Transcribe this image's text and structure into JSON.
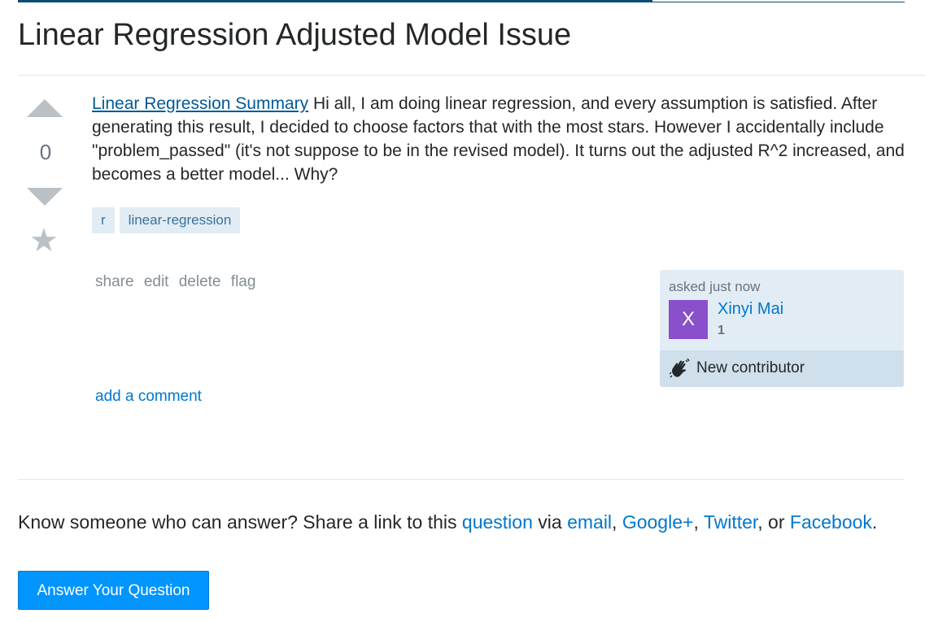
{
  "question": {
    "title": "Linear Regression Adjusted Model Issue",
    "vote_count": "0",
    "body_link": "Linear Regression Summary",
    "body_text": " Hi all, I am doing linear regression, and every assumption is satisfied. After generating this result, I decided to choose factors that with the most stars. However I accidentally include \"problem_passed\" (it's not suppose to be in the revised model). It turns out the adjusted R^2 increased, and becomes a better model... Why?",
    "tags": [
      "r",
      "linear-regression"
    ]
  },
  "post_menu": {
    "share": "share",
    "edit": "edit",
    "delete": "delete",
    "flag": "flag"
  },
  "owner": {
    "asked": "asked just now",
    "avatar_letter": "X",
    "name": "Xinyi Mai",
    "reputation": "1",
    "badge": "New contributor"
  },
  "add_comment": "add a comment",
  "share_prompt": {
    "prefix": "Know someone who can answer? Share a link to this ",
    "question_link": "question",
    "via": " via ",
    "email": "email",
    "sep1": ", ",
    "google": "Google+",
    "sep2": ", ",
    "twitter": "Twitter",
    "or": ", or ",
    "facebook": "Facebook",
    "end": "."
  },
  "answer_button": "Answer Your Question",
  "colors": {
    "link": "#0077cc",
    "tag_bg": "#e1ecf4",
    "tag_text": "#39739d",
    "button": "#0095ff",
    "avatar": "#8a4fcb"
  },
  "icons": [
    "vote-up-arrow-icon",
    "vote-down-arrow-icon",
    "favorite-star-icon",
    "wave-hand-icon"
  ]
}
